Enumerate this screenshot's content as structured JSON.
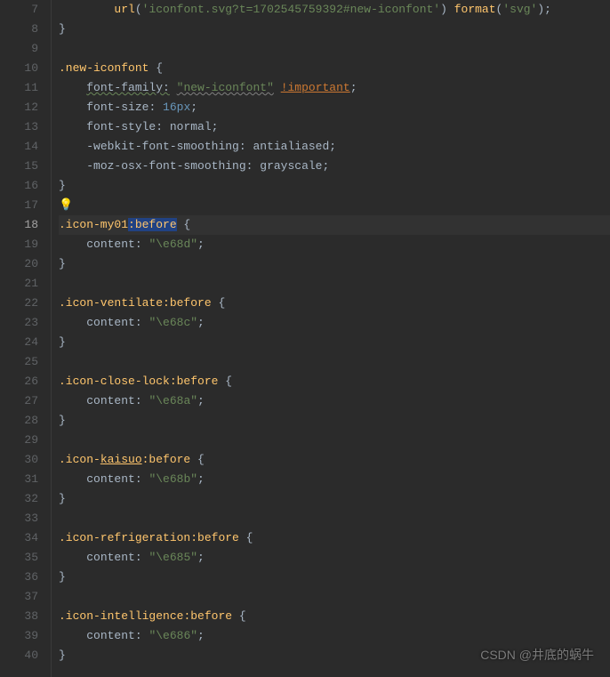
{
  "startLine": 7,
  "currentLine": 18,
  "hintLine": 17,
  "watermark": "CSDN @井底的蜗牛",
  "lines": [
    {
      "n": 7,
      "tokens": [
        {
          "t": "        ",
          "c": "ind"
        },
        {
          "t": "url",
          "c": "fn"
        },
        {
          "t": "(",
          "c": "punct"
        },
        {
          "t": "'iconfont.svg?t=1702545759392#new-iconfont'",
          "c": "str"
        },
        {
          "t": ") ",
          "c": "punct"
        },
        {
          "t": "format",
          "c": "fn"
        },
        {
          "t": "(",
          "c": "punct"
        },
        {
          "t": "'svg'",
          "c": "str"
        },
        {
          "t": ");",
          "c": "punct"
        }
      ]
    },
    {
      "n": 8,
      "tokens": [
        {
          "t": "}",
          "c": "punct"
        }
      ]
    },
    {
      "n": 9,
      "tokens": []
    },
    {
      "n": 10,
      "tokens": [
        {
          "t": ".new-iconfont ",
          "c": "selector"
        },
        {
          "t": "{",
          "c": "punct"
        }
      ]
    },
    {
      "n": 11,
      "tokens": [
        {
          "t": "    ",
          "c": "ind"
        },
        {
          "t": "font-family:",
          "c": "prop wavy-green"
        },
        {
          "t": " ",
          "c": ""
        },
        {
          "t": "\"new-iconfont\"",
          "c": "str wavy-gray"
        },
        {
          "t": " ",
          "c": ""
        },
        {
          "t": "!important",
          "c": "important underline"
        },
        {
          "t": ";",
          "c": "punct"
        }
      ]
    },
    {
      "n": 12,
      "tokens": [
        {
          "t": "    ",
          "c": "ind"
        },
        {
          "t": "font-size",
          "c": "prop"
        },
        {
          "t": ": ",
          "c": "punct"
        },
        {
          "t": "16px",
          "c": "num"
        },
        {
          "t": ";",
          "c": "punct"
        }
      ]
    },
    {
      "n": 13,
      "tokens": [
        {
          "t": "    ",
          "c": "ind"
        },
        {
          "t": "font-style",
          "c": "prop"
        },
        {
          "t": ": ",
          "c": "punct"
        },
        {
          "t": "normal",
          "c": "val"
        },
        {
          "t": ";",
          "c": "punct"
        }
      ]
    },
    {
      "n": 14,
      "tokens": [
        {
          "t": "    ",
          "c": "ind"
        },
        {
          "t": "-webkit-font-smoothing",
          "c": "prop"
        },
        {
          "t": ": ",
          "c": "punct"
        },
        {
          "t": "antialiased",
          "c": "val"
        },
        {
          "t": ";",
          "c": "punct"
        }
      ]
    },
    {
      "n": 15,
      "tokens": [
        {
          "t": "    ",
          "c": "ind"
        },
        {
          "t": "-moz-osx-font-smoothing",
          "c": "prop"
        },
        {
          "t": ": ",
          "c": "punct"
        },
        {
          "t": "grayscale",
          "c": "val"
        },
        {
          "t": ";",
          "c": "punct"
        }
      ]
    },
    {
      "n": 16,
      "tokens": [
        {
          "t": "}",
          "c": "punct"
        }
      ]
    },
    {
      "n": 17,
      "tokens": []
    },
    {
      "n": 18,
      "tokens": [
        {
          "t": ".icon-my01",
          "c": "selector"
        },
        {
          "t": ":before",
          "c": "pseudo sel-highlight"
        },
        {
          "t": " {",
          "c": "punct"
        }
      ]
    },
    {
      "n": 19,
      "tokens": [
        {
          "t": "    ",
          "c": "ind"
        },
        {
          "t": "content",
          "c": "prop"
        },
        {
          "t": ": ",
          "c": "punct"
        },
        {
          "t": "\"\\e68d\"",
          "c": "str"
        },
        {
          "t": ";",
          "c": "punct"
        }
      ]
    },
    {
      "n": 20,
      "tokens": [
        {
          "t": "}",
          "c": "punct"
        }
      ]
    },
    {
      "n": 21,
      "tokens": []
    },
    {
      "n": 22,
      "tokens": [
        {
          "t": ".icon-ventilate",
          "c": "selector"
        },
        {
          "t": ":before",
          "c": "pseudo"
        },
        {
          "t": " {",
          "c": "punct"
        }
      ]
    },
    {
      "n": 23,
      "tokens": [
        {
          "t": "    ",
          "c": "ind"
        },
        {
          "t": "content",
          "c": "prop"
        },
        {
          "t": ": ",
          "c": "punct"
        },
        {
          "t": "\"\\e68c\"",
          "c": "str"
        },
        {
          "t": ";",
          "c": "punct"
        }
      ]
    },
    {
      "n": 24,
      "tokens": [
        {
          "t": "}",
          "c": "punct"
        }
      ]
    },
    {
      "n": 25,
      "tokens": []
    },
    {
      "n": 26,
      "tokens": [
        {
          "t": ".icon-close-lock",
          "c": "selector"
        },
        {
          "t": ":before",
          "c": "pseudo"
        },
        {
          "t": " {",
          "c": "punct"
        }
      ]
    },
    {
      "n": 27,
      "tokens": [
        {
          "t": "    ",
          "c": "ind"
        },
        {
          "t": "content",
          "c": "prop"
        },
        {
          "t": ": ",
          "c": "punct"
        },
        {
          "t": "\"\\e68a\"",
          "c": "str"
        },
        {
          "t": ";",
          "c": "punct"
        }
      ]
    },
    {
      "n": 28,
      "tokens": [
        {
          "t": "}",
          "c": "punct"
        }
      ]
    },
    {
      "n": 29,
      "tokens": []
    },
    {
      "n": 30,
      "tokens": [
        {
          "t": ".icon-",
          "c": "selector"
        },
        {
          "t": "kaisuo",
          "c": "selector underline"
        },
        {
          "t": ":before",
          "c": "pseudo"
        },
        {
          "t": " {",
          "c": "punct"
        }
      ]
    },
    {
      "n": 31,
      "tokens": [
        {
          "t": "    ",
          "c": "ind"
        },
        {
          "t": "content",
          "c": "prop"
        },
        {
          "t": ": ",
          "c": "punct"
        },
        {
          "t": "\"\\e68b\"",
          "c": "str"
        },
        {
          "t": ";",
          "c": "punct"
        }
      ]
    },
    {
      "n": 32,
      "tokens": [
        {
          "t": "}",
          "c": "punct"
        }
      ]
    },
    {
      "n": 33,
      "tokens": []
    },
    {
      "n": 34,
      "tokens": [
        {
          "t": ".icon-refrigeration",
          "c": "selector"
        },
        {
          "t": ":before",
          "c": "pseudo"
        },
        {
          "t": " {",
          "c": "punct"
        }
      ]
    },
    {
      "n": 35,
      "tokens": [
        {
          "t": "    ",
          "c": "ind"
        },
        {
          "t": "content",
          "c": "prop"
        },
        {
          "t": ": ",
          "c": "punct"
        },
        {
          "t": "\"\\e685\"",
          "c": "str"
        },
        {
          "t": ";",
          "c": "punct"
        }
      ]
    },
    {
      "n": 36,
      "tokens": [
        {
          "t": "}",
          "c": "punct"
        }
      ]
    },
    {
      "n": 37,
      "tokens": []
    },
    {
      "n": 38,
      "tokens": [
        {
          "t": ".icon-intelligence",
          "c": "selector"
        },
        {
          "t": ":before",
          "c": "pseudo"
        },
        {
          "t": " {",
          "c": "punct"
        }
      ]
    },
    {
      "n": 39,
      "tokens": [
        {
          "t": "    ",
          "c": "ind"
        },
        {
          "t": "content",
          "c": "prop"
        },
        {
          "t": ": ",
          "c": "punct"
        },
        {
          "t": "\"\\e686\"",
          "c": "str"
        },
        {
          "t": ";",
          "c": "punct"
        }
      ]
    },
    {
      "n": 40,
      "tokens": [
        {
          "t": "}",
          "c": "punct"
        }
      ]
    }
  ]
}
